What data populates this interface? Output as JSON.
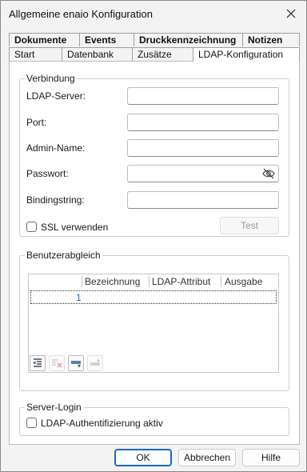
{
  "window": {
    "title": "Allgemeine enaio  Konfiguration"
  },
  "tabs": {
    "row1": [
      "Dokumente",
      "Events",
      "Druckkennzeichnung",
      "Notizen"
    ],
    "row2": [
      "Start",
      "Datenbank",
      "Zusätze",
      "LDAP-Konfiguration"
    ],
    "active": "LDAP-Konfiguration"
  },
  "verbindung": {
    "legend": "Verbindung",
    "ldap_server_label": "LDAP-Server:",
    "ldap_server_value": "",
    "port_label": "Port:",
    "port_value": "",
    "admin_label": "Admin-Name:",
    "admin_value": "",
    "password_label": "Passwort:",
    "password_value": "",
    "bindingstring_label": "Bindingstring:",
    "bindingstring_value": "",
    "ssl_label": "SSL verwenden",
    "ssl_checked": false,
    "test_button": "Test"
  },
  "benutzerabgleich": {
    "legend": "Benutzerabgleich",
    "columns": [
      "Bezeichnung",
      "LDAP-Attribut",
      "Ausgabe"
    ],
    "rows": [
      {
        "num": "1",
        "bezeichnung": "",
        "ldap_attribut": "",
        "ausgabe": ""
      }
    ]
  },
  "server_login": {
    "legend": "Server-Login",
    "ldap_auth_label": "LDAP-Authentifizierung aktiv",
    "ldap_auth_checked": false
  },
  "footer": {
    "ok": "OK",
    "cancel": "Abbrechen",
    "help": "Hilfe"
  },
  "colors": {
    "accent": "#1a66c8",
    "window_bg": "#f3f3f3",
    "panel_bg": "#ffffff"
  }
}
